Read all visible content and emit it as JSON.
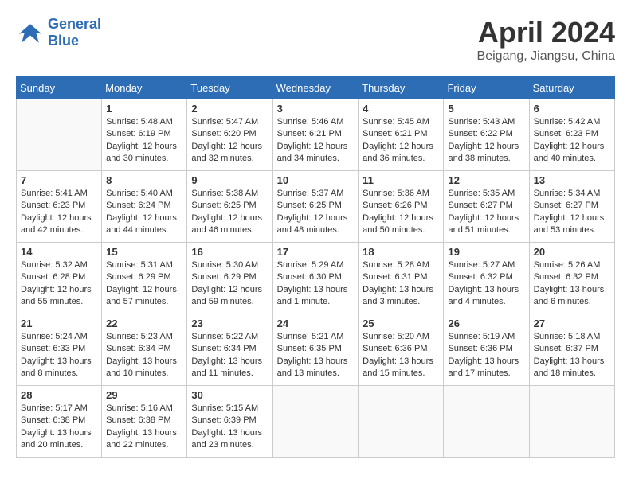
{
  "header": {
    "logo_text_general": "General",
    "logo_text_blue": "Blue",
    "month_year": "April 2024",
    "location": "Beigang, Jiangsu, China"
  },
  "calendar": {
    "days_of_week": [
      "Sunday",
      "Monday",
      "Tuesday",
      "Wednesday",
      "Thursday",
      "Friday",
      "Saturday"
    ],
    "weeks": [
      [
        {
          "day": "",
          "sunrise": "",
          "sunset": "",
          "daylight": ""
        },
        {
          "day": "1",
          "sunrise": "Sunrise: 5:48 AM",
          "sunset": "Sunset: 6:19 PM",
          "daylight": "Daylight: 12 hours and 30 minutes."
        },
        {
          "day": "2",
          "sunrise": "Sunrise: 5:47 AM",
          "sunset": "Sunset: 6:20 PM",
          "daylight": "Daylight: 12 hours and 32 minutes."
        },
        {
          "day": "3",
          "sunrise": "Sunrise: 5:46 AM",
          "sunset": "Sunset: 6:21 PM",
          "daylight": "Daylight: 12 hours and 34 minutes."
        },
        {
          "day": "4",
          "sunrise": "Sunrise: 5:45 AM",
          "sunset": "Sunset: 6:21 PM",
          "daylight": "Daylight: 12 hours and 36 minutes."
        },
        {
          "day": "5",
          "sunrise": "Sunrise: 5:43 AM",
          "sunset": "Sunset: 6:22 PM",
          "daylight": "Daylight: 12 hours and 38 minutes."
        },
        {
          "day": "6",
          "sunrise": "Sunrise: 5:42 AM",
          "sunset": "Sunset: 6:23 PM",
          "daylight": "Daylight: 12 hours and 40 minutes."
        }
      ],
      [
        {
          "day": "7",
          "sunrise": "Sunrise: 5:41 AM",
          "sunset": "Sunset: 6:23 PM",
          "daylight": "Daylight: 12 hours and 42 minutes."
        },
        {
          "day": "8",
          "sunrise": "Sunrise: 5:40 AM",
          "sunset": "Sunset: 6:24 PM",
          "daylight": "Daylight: 12 hours and 44 minutes."
        },
        {
          "day": "9",
          "sunrise": "Sunrise: 5:38 AM",
          "sunset": "Sunset: 6:25 PM",
          "daylight": "Daylight: 12 hours and 46 minutes."
        },
        {
          "day": "10",
          "sunrise": "Sunrise: 5:37 AM",
          "sunset": "Sunset: 6:25 PM",
          "daylight": "Daylight: 12 hours and 48 minutes."
        },
        {
          "day": "11",
          "sunrise": "Sunrise: 5:36 AM",
          "sunset": "Sunset: 6:26 PM",
          "daylight": "Daylight: 12 hours and 50 minutes."
        },
        {
          "day": "12",
          "sunrise": "Sunrise: 5:35 AM",
          "sunset": "Sunset: 6:27 PM",
          "daylight": "Daylight: 12 hours and 51 minutes."
        },
        {
          "day": "13",
          "sunrise": "Sunrise: 5:34 AM",
          "sunset": "Sunset: 6:27 PM",
          "daylight": "Daylight: 12 hours and 53 minutes."
        }
      ],
      [
        {
          "day": "14",
          "sunrise": "Sunrise: 5:32 AM",
          "sunset": "Sunset: 6:28 PM",
          "daylight": "Daylight: 12 hours and 55 minutes."
        },
        {
          "day": "15",
          "sunrise": "Sunrise: 5:31 AM",
          "sunset": "Sunset: 6:29 PM",
          "daylight": "Daylight: 12 hours and 57 minutes."
        },
        {
          "day": "16",
          "sunrise": "Sunrise: 5:30 AM",
          "sunset": "Sunset: 6:29 PM",
          "daylight": "Daylight: 12 hours and 59 minutes."
        },
        {
          "day": "17",
          "sunrise": "Sunrise: 5:29 AM",
          "sunset": "Sunset: 6:30 PM",
          "daylight": "Daylight: 13 hours and 1 minute."
        },
        {
          "day": "18",
          "sunrise": "Sunrise: 5:28 AM",
          "sunset": "Sunset: 6:31 PM",
          "daylight": "Daylight: 13 hours and 3 minutes."
        },
        {
          "day": "19",
          "sunrise": "Sunrise: 5:27 AM",
          "sunset": "Sunset: 6:32 PM",
          "daylight": "Daylight: 13 hours and 4 minutes."
        },
        {
          "day": "20",
          "sunrise": "Sunrise: 5:26 AM",
          "sunset": "Sunset: 6:32 PM",
          "daylight": "Daylight: 13 hours and 6 minutes."
        }
      ],
      [
        {
          "day": "21",
          "sunrise": "Sunrise: 5:24 AM",
          "sunset": "Sunset: 6:33 PM",
          "daylight": "Daylight: 13 hours and 8 minutes."
        },
        {
          "day": "22",
          "sunrise": "Sunrise: 5:23 AM",
          "sunset": "Sunset: 6:34 PM",
          "daylight": "Daylight: 13 hours and 10 minutes."
        },
        {
          "day": "23",
          "sunrise": "Sunrise: 5:22 AM",
          "sunset": "Sunset: 6:34 PM",
          "daylight": "Daylight: 13 hours and 11 minutes."
        },
        {
          "day": "24",
          "sunrise": "Sunrise: 5:21 AM",
          "sunset": "Sunset: 6:35 PM",
          "daylight": "Daylight: 13 hours and 13 minutes."
        },
        {
          "day": "25",
          "sunrise": "Sunrise: 5:20 AM",
          "sunset": "Sunset: 6:36 PM",
          "daylight": "Daylight: 13 hours and 15 minutes."
        },
        {
          "day": "26",
          "sunrise": "Sunrise: 5:19 AM",
          "sunset": "Sunset: 6:36 PM",
          "daylight": "Daylight: 13 hours and 17 minutes."
        },
        {
          "day": "27",
          "sunrise": "Sunrise: 5:18 AM",
          "sunset": "Sunset: 6:37 PM",
          "daylight": "Daylight: 13 hours and 18 minutes."
        }
      ],
      [
        {
          "day": "28",
          "sunrise": "Sunrise: 5:17 AM",
          "sunset": "Sunset: 6:38 PM",
          "daylight": "Daylight: 13 hours and 20 minutes."
        },
        {
          "day": "29",
          "sunrise": "Sunrise: 5:16 AM",
          "sunset": "Sunset: 6:38 PM",
          "daylight": "Daylight: 13 hours and 22 minutes."
        },
        {
          "day": "30",
          "sunrise": "Sunrise: 5:15 AM",
          "sunset": "Sunset: 6:39 PM",
          "daylight": "Daylight: 13 hours and 23 minutes."
        },
        {
          "day": "",
          "sunrise": "",
          "sunset": "",
          "daylight": ""
        },
        {
          "day": "",
          "sunrise": "",
          "sunset": "",
          "daylight": ""
        },
        {
          "day": "",
          "sunrise": "",
          "sunset": "",
          "daylight": ""
        },
        {
          "day": "",
          "sunrise": "",
          "sunset": "",
          "daylight": ""
        }
      ]
    ]
  }
}
